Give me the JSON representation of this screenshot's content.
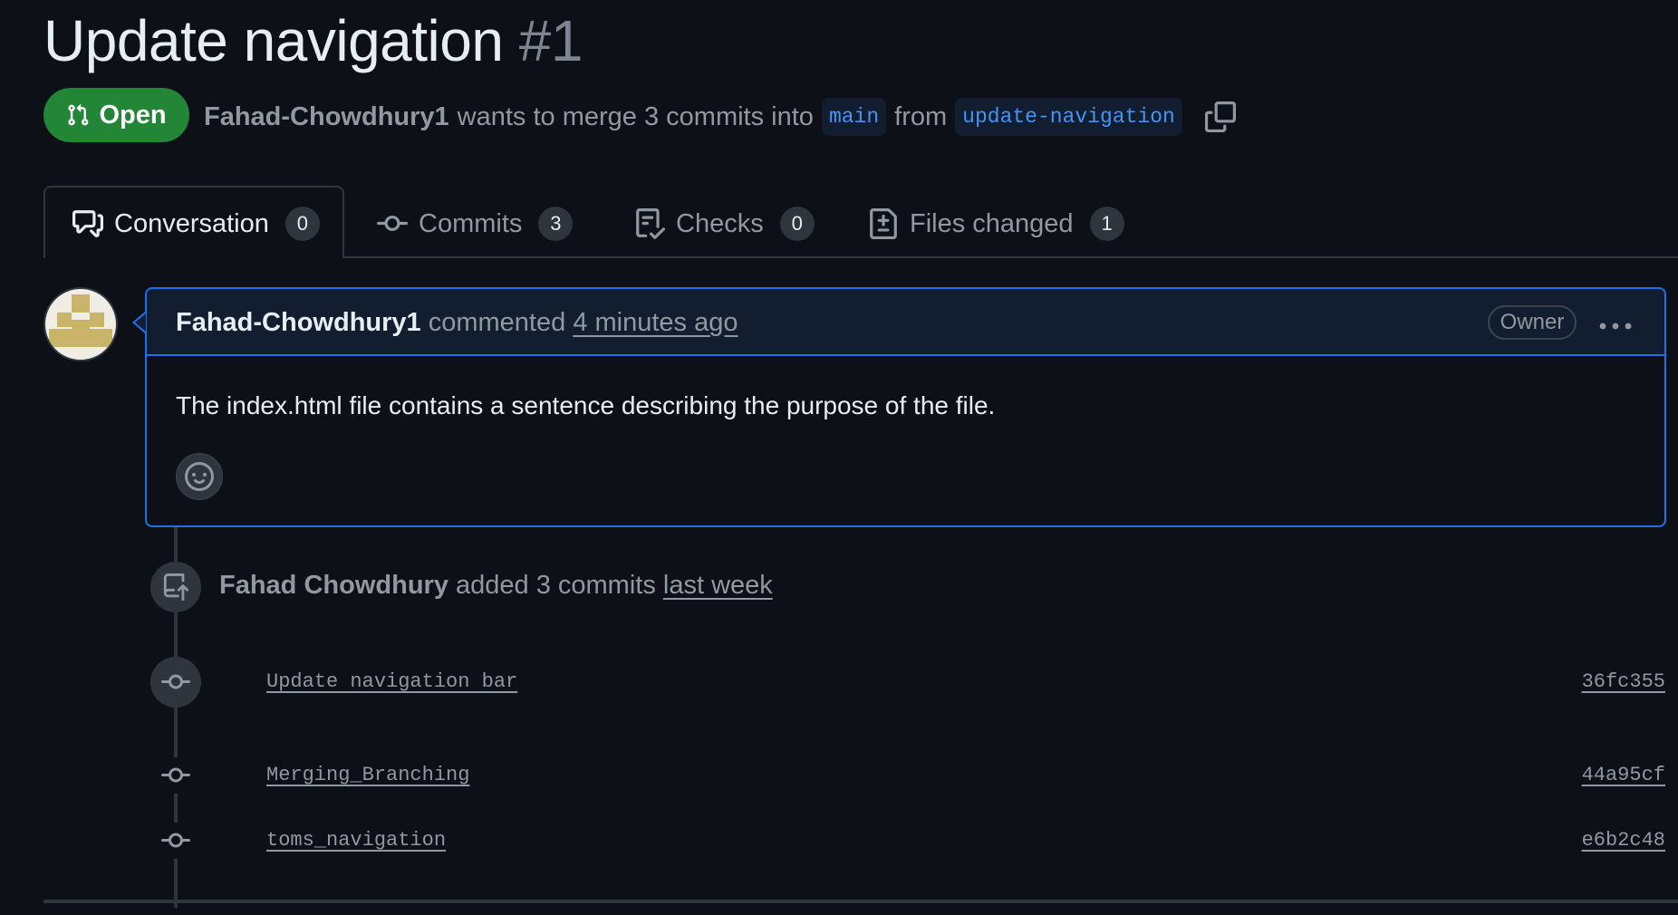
{
  "pr": {
    "title": "Update navigation",
    "number": "#1",
    "status": "Open",
    "author": "Fahad-Chowdhury1",
    "merge_text": "wants to merge 3 commits into",
    "base_branch": "main",
    "from_text": "from",
    "head_branch": "update-navigation"
  },
  "tabs": [
    {
      "label": "Conversation",
      "count": "0",
      "icon": "comment-discussion-icon"
    },
    {
      "label": "Commits",
      "count": "3",
      "icon": "git-commit-icon"
    },
    {
      "label": "Checks",
      "count": "0",
      "icon": "checklist-icon"
    },
    {
      "label": "Files changed",
      "count": "1",
      "icon": "file-diff-icon"
    }
  ],
  "comment": {
    "author": "Fahad-Chowdhury1",
    "action": "commented",
    "time": "4 minutes ago",
    "role": "Owner",
    "body": "The index.html file contains a sentence describing the purpose of the file."
  },
  "timeline_event": {
    "author": "Fahad Chowdhury",
    "action": "added 3 commits",
    "when": "last week"
  },
  "commits": [
    {
      "message": "Update navigation bar",
      "sha": "36fc355"
    },
    {
      "message": "Merging_Branching",
      "sha": "44a95cf"
    },
    {
      "message": "toms_navigation",
      "sha": "e6b2c48"
    }
  ],
  "colors": {
    "background": "#0d1117",
    "open_green": "#238636",
    "accent_blue": "#1f6feb",
    "link_blue": "#4493f8",
    "muted": "#9198a1"
  }
}
